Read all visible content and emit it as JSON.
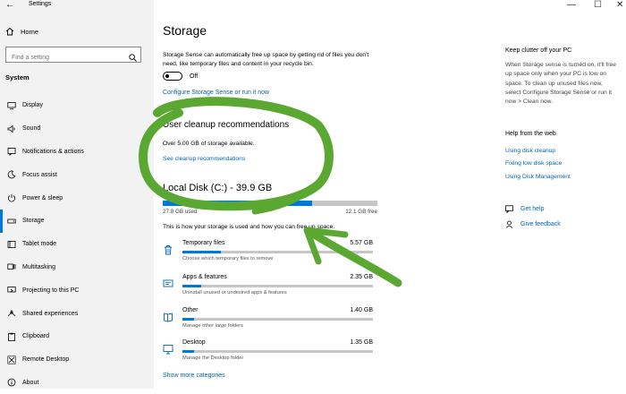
{
  "window": {
    "title": "Settings",
    "back_glyph": "←",
    "min_glyph": "—",
    "max_glyph": "☐",
    "close_glyph": "✕"
  },
  "sidebar": {
    "home": "Home",
    "search_placeholder": "Find a setting",
    "section": "System",
    "items": [
      {
        "label": "Display",
        "icon": "monitor-icon"
      },
      {
        "label": "Sound",
        "icon": "speaker-icon"
      },
      {
        "label": "Notifications & actions",
        "icon": "notification-icon"
      },
      {
        "label": "Focus assist",
        "icon": "moon-icon"
      },
      {
        "label": "Power & sleep",
        "icon": "power-icon"
      },
      {
        "label": "Storage",
        "icon": "storage-icon",
        "active": true
      },
      {
        "label": "Tablet mode",
        "icon": "tablet-icon"
      },
      {
        "label": "Multitasking",
        "icon": "multitasking-icon"
      },
      {
        "label": "Projecting to this PC",
        "icon": "projector-icon"
      },
      {
        "label": "Shared experiences",
        "icon": "shared-icon"
      },
      {
        "label": "Clipboard",
        "icon": "clipboard-icon"
      },
      {
        "label": "Remote Desktop",
        "icon": "remote-desktop-icon"
      },
      {
        "label": "About",
        "icon": "info-icon"
      }
    ]
  },
  "main": {
    "title": "Storage",
    "description": "Storage Sense can automatically free up space by getting rid of files you don't need, like temporary files and content in your recycle bin.",
    "toggle_state": "Off",
    "configure_link": "Configure Storage Sense or run it now",
    "cleanup_title": "User cleanup recommendations",
    "cleanup_text": "Over 5.00 GB of storage available.",
    "cleanup_link": "See cleanup recommendations",
    "disk_title": "Local Disk (C:) - 39.9 GB",
    "disk_used": "27.8 GB used",
    "disk_free": "12.1 GB free",
    "disk_used_fraction": 0.697,
    "how_text": "This is how your storage is used and how you can free up space.",
    "categories": [
      {
        "name": "Temporary files",
        "size": "5.57 GB",
        "sub": "Choose which temporary files to remove",
        "fraction": 0.2,
        "icon": "trash-icon"
      },
      {
        "name": "Apps & features",
        "size": "2.35 GB",
        "sub": "Uninstall unused or undesired apps & features",
        "fraction": 0.1,
        "icon": "apps-icon"
      },
      {
        "name": "Other",
        "size": "1.40 GB",
        "sub": "Manage other large folders",
        "fraction": 0.06,
        "icon": "other-icon"
      },
      {
        "name": "Desktop",
        "size": "1.35 GB",
        "sub": "Manage the Desktop folder",
        "fraction": 0.06,
        "icon": "desktop-icon"
      }
    ],
    "more_link": "Show more categories"
  },
  "right": {
    "clutter_title": "Keep clutter off your PC",
    "clutter_text": "When Storage sense is turned on, it'll free up space only when your PC is low on space. To clean up unused files now, select Configure Storage Sense or run it now > Clean now.",
    "help_title": "Help from the web",
    "help_links": [
      "Using disk cleanup",
      "Fixing low disk space",
      "Using Disk Management"
    ],
    "get_help": "Get help",
    "feedback": "Give feedback"
  },
  "colors": {
    "accent": "#0078d7",
    "link": "#0063b1",
    "marker": "#5aa832",
    "sidebar_bg": "#f2f2f2"
  }
}
